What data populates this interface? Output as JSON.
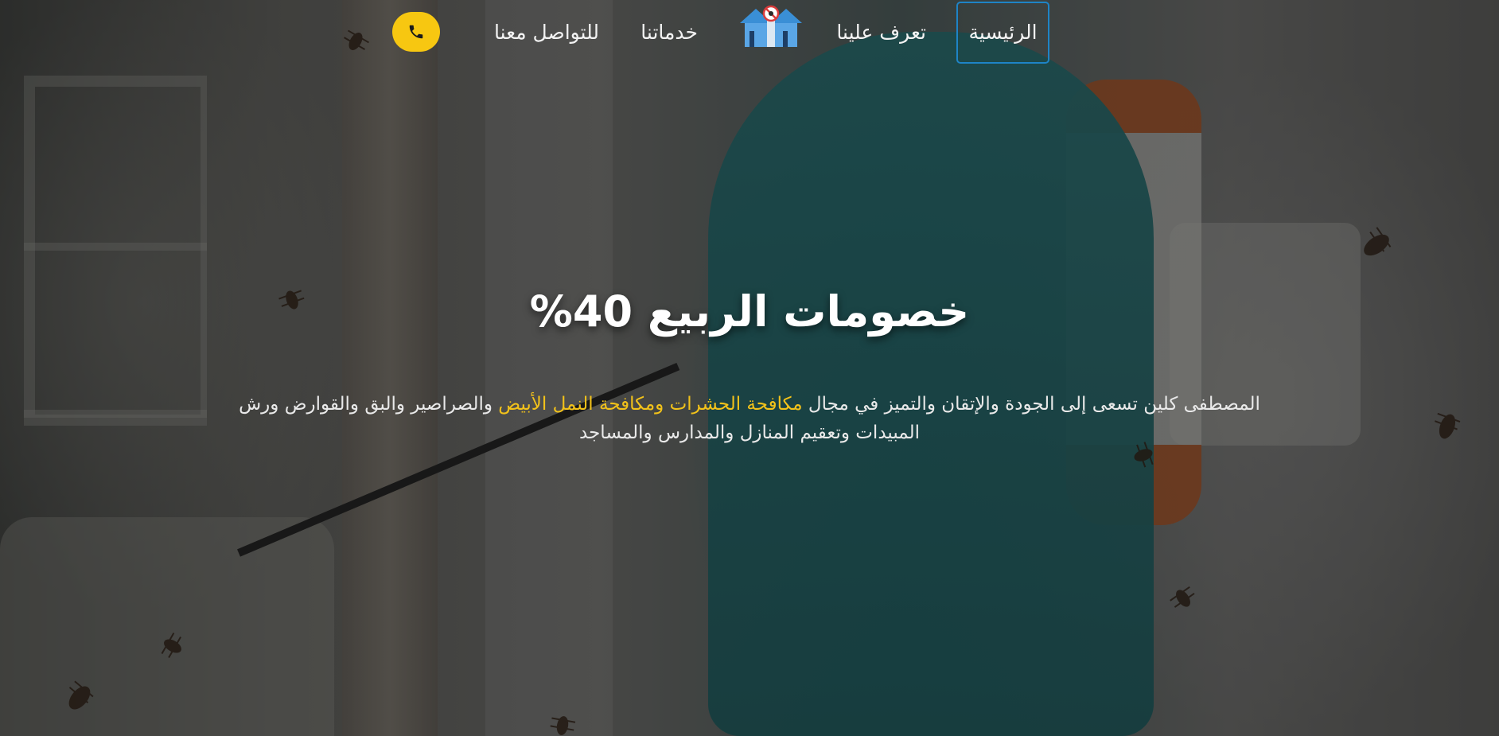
{
  "nav": {
    "home": "الرئيسية",
    "about": "تعرف علينا",
    "services": "خدماتنا",
    "contact": "للتواصل معنا",
    "logo_icon": "house-pest-control-logo-icon",
    "call_icon": "phone-icon"
  },
  "hero": {
    "headline": "خصومات الربيع 40%",
    "desc_before": "المصطفى كلين تسعى إلى الجودة والإتقان والتميز في مجال ",
    "desc_highlight": "مكافحة الحشرات ومكافحة النمل الأبيض",
    "desc_after": " والصراصير والبق والقوارض ورش المبيدات وتعقيم المنازل والمدارس والمساجد"
  },
  "colors": {
    "accent_yellow": "#f7c711",
    "highlight_text": "#f2c21a",
    "active_border": "#1e84c6"
  }
}
